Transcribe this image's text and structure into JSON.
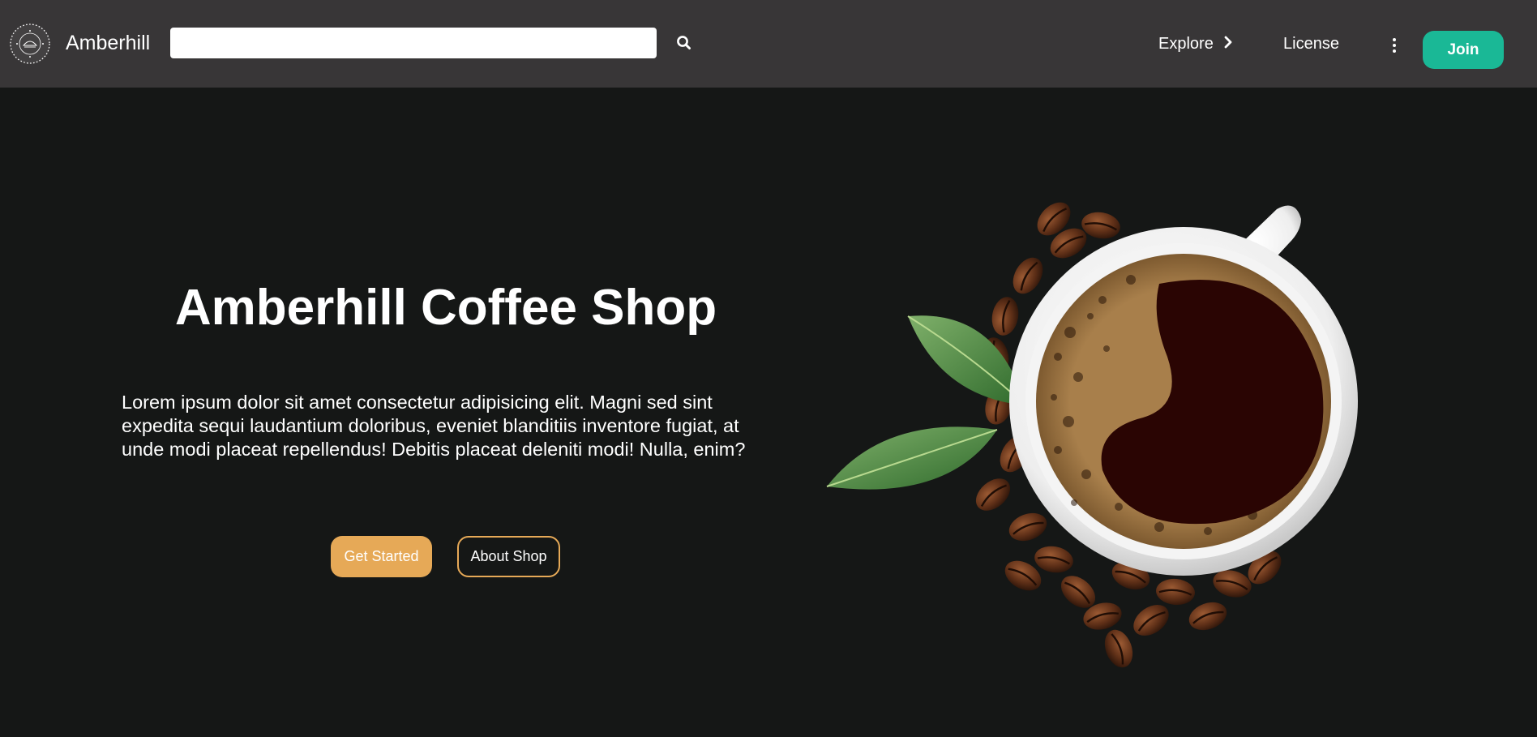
{
  "navbar": {
    "brand": "Amberhill",
    "logo_icon": "coffee-shop-logo",
    "search": {
      "value": "",
      "placeholder": ""
    },
    "search_icon": "search-icon",
    "links": [
      {
        "label": "Explore",
        "icon": "chevron-right-icon"
      },
      {
        "label": "License"
      }
    ],
    "more_icon": "vertical-ellipsis-icon",
    "join_label": "Join"
  },
  "hero": {
    "title": "Amberhill Coffee Shop",
    "description": "Lorem ipsum dolor sit amet consectetur adipisicing elit. Magni sed sint expedita sequi laudantium doloribus, eveniet blanditiis inventore fugiat, at unde modi placeat repellendus! Debitis placeat deleniti modi! Nulla, enim?",
    "primary_button": "Get Started",
    "secondary_button": "About Shop",
    "image": "coffee-cup-with-beans-and-leaves"
  },
  "colors": {
    "navbar_bg": "#383637",
    "page_bg": "#151716",
    "accent_join": "#1ab896",
    "accent_orange": "#e6a957",
    "coffee": "#2a0503",
    "crema": "#8c6a3e"
  }
}
